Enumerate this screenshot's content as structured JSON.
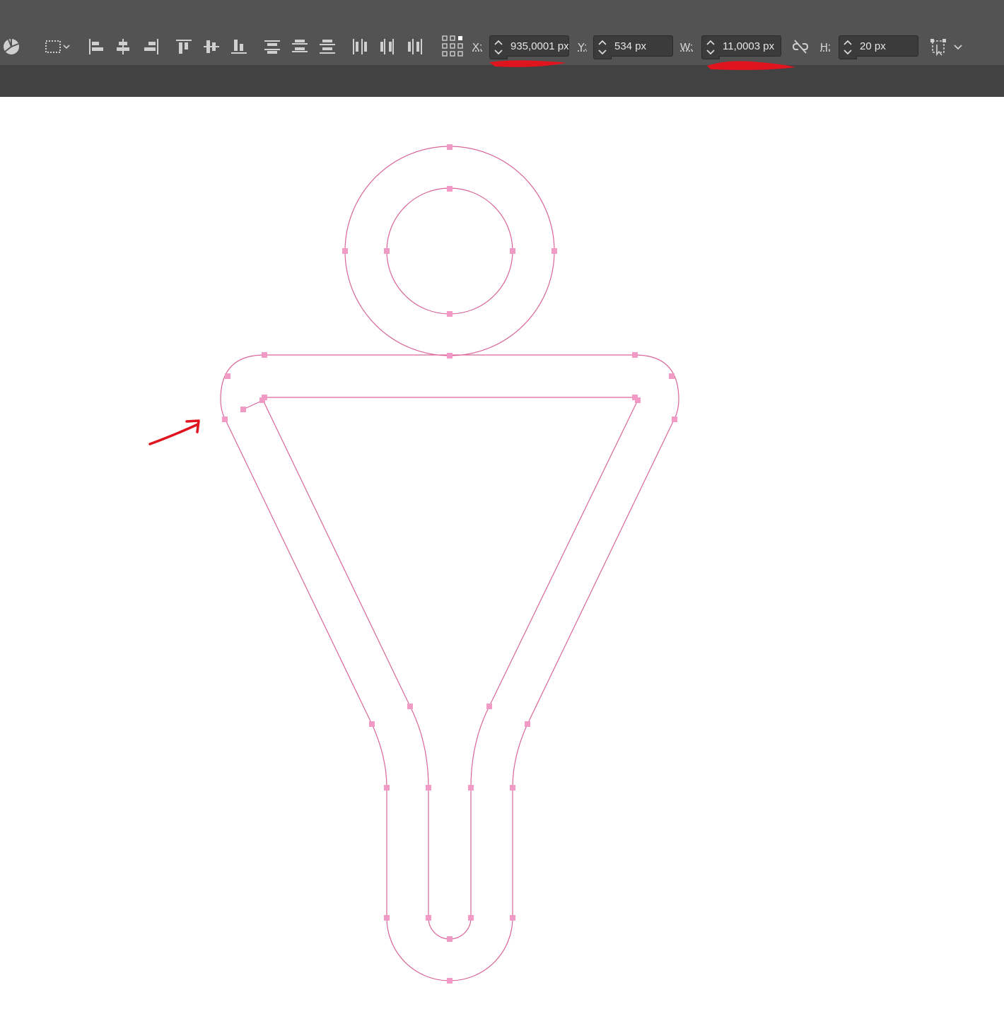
{
  "toolbar": {
    "x_label": "X:",
    "x_value": "935,0001 px",
    "y_label": "Y:",
    "y_value": "534 px",
    "w_label": "W:",
    "w_value": "11,0003 px",
    "h_label": "H:",
    "h_value": "20 px",
    "icons": [
      "path-operations-icon",
      "path-alignment-icon",
      "align-left-icon",
      "align-horizontal-center-icon",
      "align-right-icon",
      "align-top-icon",
      "align-vertical-center-icon",
      "align-bottom-icon",
      "distribute-top-icon",
      "distribute-vertical-center-icon",
      "distribute-bottom-icon",
      "distribute-left-icon",
      "distribute-horizontal-center-icon",
      "distribute-right-icon",
      "reference-point-icon",
      "link-dimensions-icon",
      "transform-options-icon"
    ]
  },
  "colors": {
    "toolbar_bg": "#535353",
    "lower_bar_bg": "#424242",
    "path_stroke": "#d9669a",
    "anchor_point": "#f29ac6",
    "annotation_red": "#e0141e"
  }
}
